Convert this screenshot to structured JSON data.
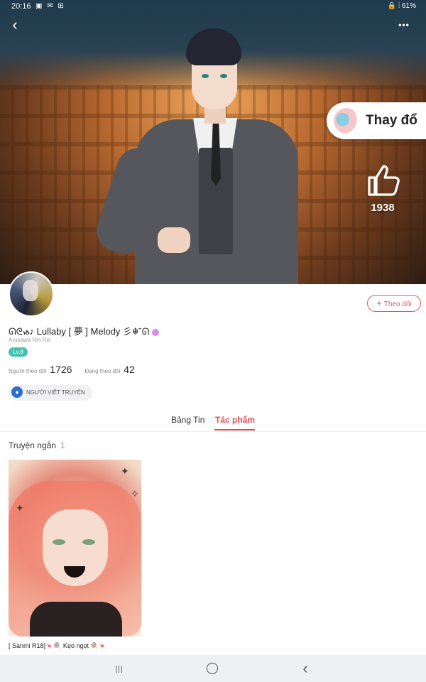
{
  "status_bar": {
    "time": "20:16",
    "icons": "▣ ✉ ⊞",
    "right": "🔒 ⫶ 61%"
  },
  "header": {
    "back_icon": "‹",
    "more_icon": "•••"
  },
  "hero": {
    "change_label": "Thay đổ",
    "like_count": "1938"
  },
  "profile": {
    "follow_label": "Theo dõi",
    "username": "ᘏᘓᏹ♪ Lullaby [ 夢 ] Melody 彡☬˘ᘏ",
    "handle": "Arusawa Rin Rin",
    "level": "Lv.8",
    "followers_label": "Người theo dõi",
    "followers_count": "1726",
    "following_label": "Đang theo dõi",
    "following_count": "42",
    "badge_label": "NGƯỜI VIẾT TRUYỆN"
  },
  "tabs": [
    {
      "label": "Bảng Tin",
      "active": false
    },
    {
      "label": "Tác phẩm",
      "active": true
    }
  ],
  "works": {
    "section_title": "Truyện ngắn",
    "section_count": "1",
    "items": [
      {
        "title": "[ Sanmi R18]🍬🍭 Kẹo ngọt 🍭🍬"
      }
    ]
  },
  "navbar": {
    "recent_icon": "|||",
    "home_icon": "◯",
    "back_icon": "‹"
  },
  "colors": {
    "accent": "#e0504f",
    "level": "#45c1b2",
    "badge_icon": "#2b6fcb"
  }
}
